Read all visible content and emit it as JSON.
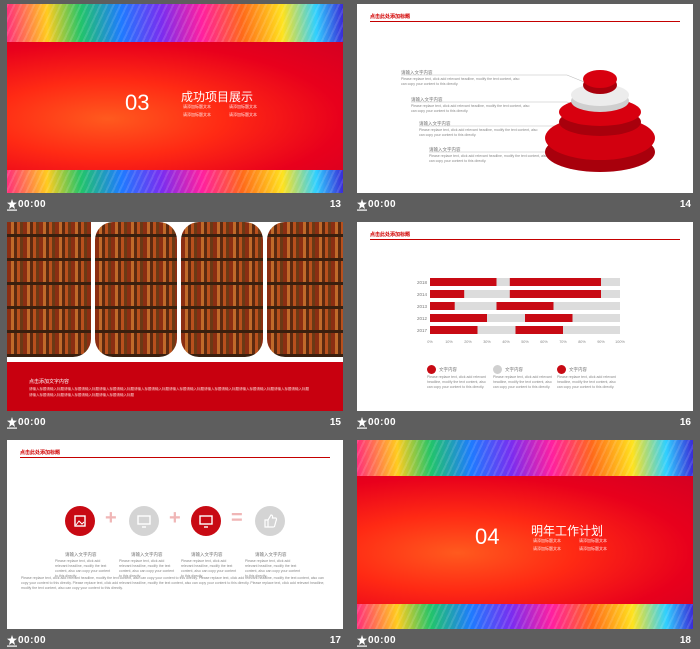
{
  "slides": [
    {
      "number": "13",
      "time": "00:00",
      "section_num": "03",
      "title": "成功项目展示",
      "sub": [
        "请添加标题文本",
        "请添加标题文本",
        "请添加标题文本",
        "请添加标题文本"
      ]
    },
    {
      "number": "14",
      "time": "00:00",
      "header": "点击此处添加标题",
      "items": [
        {
          "title": "请输入文字内容",
          "body": "Please replace text, click add relevant headline, modify the text content, also can copy your content to this directly."
        },
        {
          "title": "请输入文字内容",
          "body": "Please replace text, click add relevant headline, modify the text content, also can copy your content to this directly."
        },
        {
          "title": "请输入文字内容",
          "body": "Please replace text, click add relevant headline, modify the text content, also can copy your content to this directly."
        },
        {
          "title": "请输入文字内容",
          "body": "Please replace text, click add relevant headline, modify the text content, also can copy your content to this directly."
        }
      ]
    },
    {
      "number": "15",
      "time": "00:00",
      "caption": "点击添加文字内容",
      "lines": [
        "请输入标题请输入标题请输入标题请输入标题请输入标题请输入标题请输入标题请输入标题请输入标题请输入标题请输入标题请输入标题请输入标题请输入标题请输入标题请输入标题",
        "请输入标题请输入标题请输入标题请输入标题请输入标题请输入标题"
      ]
    },
    {
      "number": "16",
      "time": "00:00",
      "header": "点击此处添加标题",
      "legend": [
        {
          "title": "文字内容",
          "color": "#c80a14",
          "body": "Please replace text, click add relevant headline, modify the text content, also can copy your content to this directly."
        },
        {
          "title": "文字内容",
          "color": "#d0d0d0",
          "body": "Please replace text, click add relevant headline, modify the text content, also can copy your content to this directly."
        },
        {
          "title": "文字内容",
          "color": "#c80a14",
          "body": "Please replace text, click add relevant headline, modify the text content, also can copy your content to this directly."
        }
      ]
    },
    {
      "number": "17",
      "time": "00:00",
      "header": "点击此处添加标题",
      "items": [
        {
          "title": "请输入文字内容",
          "body": "Please replace text, click add relevant headline, modify the text content, also can copy your content to this directly."
        },
        {
          "title": "请输入文字内容",
          "body": "Please replace text, click add relevant headline, modify the text content, also can copy your content to this directly."
        },
        {
          "title": "请输入文字内容",
          "body": "Please replace text, click add relevant headline, modify the text content, also can copy your content to this directly."
        },
        {
          "title": "请输入文字内容",
          "body": "Please replace text, click add relevant headline, modify the text content, also can copy your content to this directly."
        }
      ],
      "footer": "Please replace text, click add relevant headline, modify the text content, also can copy your content to this directly. Please replace text, click add relevant headline, modify the text content, also can copy your content to this directly. Please replace text, click add relevant headline, modify the text content, also can copy your content to this directly. Please replace text, click add relevant headline, modify the text content, also can copy your content to this directly."
    },
    {
      "number": "18",
      "time": "00:00",
      "section_num": "04",
      "title": "明年工作计划",
      "sub": [
        "请添加标题文本",
        "请添加标题文本",
        "请添加标题文本",
        "请添加标题文本"
      ]
    }
  ],
  "chart_data": {
    "type": "bar",
    "categories": [
      "2018",
      "2014",
      "2013",
      "2012",
      "2017"
    ],
    "x_ticks": [
      "0%",
      "10%",
      "20%",
      "30%",
      "40%",
      "50%",
      "60%",
      "70%",
      "80%",
      "90%",
      "100%"
    ],
    "xlim": [
      0,
      100
    ],
    "series": [
      {
        "values": [
          [
            0,
            35
          ],
          [
            42,
            90
          ]
        ]
      },
      {
        "values": [
          [
            0,
            18
          ],
          [
            42,
            90
          ]
        ]
      },
      {
        "values": [
          [
            0,
            13
          ],
          [
            35,
            65
          ]
        ]
      },
      {
        "values": [
          [
            0,
            30
          ],
          [
            50,
            75
          ]
        ]
      },
      {
        "values": [
          [
            0,
            25
          ],
          [
            45,
            70
          ]
        ]
      }
    ]
  },
  "colors": {
    "accent": "#c80a14",
    "background": "#5e5e5e"
  }
}
